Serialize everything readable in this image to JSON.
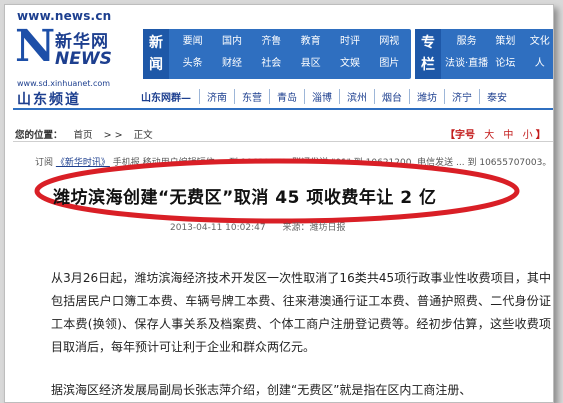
{
  "header": {
    "site_url": "www.news.cn",
    "logo_letter": "N",
    "logo_cn": "新华网",
    "logo_news": "NEWS",
    "sub_url": "www.sd.xinhuanet.com",
    "channel_name": "山东频道"
  },
  "nav_news": {
    "label": "新闻",
    "items": [
      "要闻",
      "国内",
      "齐鲁",
      "教育",
      "时评",
      "网视",
      "头条",
      "财经",
      "社会",
      "县区",
      "文娱",
      "图片"
    ]
  },
  "nav_topics": {
    "label": "专栏",
    "items": [
      "服务",
      "策划",
      "文化",
      "法谈·直播",
      "论坛",
      "人"
    ]
  },
  "city_bar": {
    "net_label": "山东网群—",
    "cities": [
      "济南",
      "东营",
      "青岛",
      "淄博",
      "滨州",
      "烟台",
      "潍坊",
      "济宁",
      "泰安"
    ]
  },
  "breadcrumb": {
    "location_label": "您的位置：",
    "items": [
      "首页",
      "> >",
      "正文"
    ]
  },
  "font_size": {
    "label": "【字号",
    "options": [
      "大",
      "中",
      "小"
    ],
    "close": "】"
  },
  "subscribe_line": {
    "prefix": "订阅",
    "link": "《新华时讯》",
    "tail": "手机报 移动用户编辑短信 ... 到 10621200, 联通发送 \"01\" 到 10621200, 电信发送 ... 到 10655707003。"
  },
  "article": {
    "headline": "潍坊滨海创建“无费区”取消 45 项收费年让 2 亿",
    "date": "2013-04-11 10:02:47",
    "source": "来源：潍坊日报",
    "paragraph_1": "从3月26日起，潍坊滨海经济技术开发区一次性取消了16类共45项行政事业性收费项目，其中包括居民户口簿工本费、车辆号牌工本费、往来港澳通行证工本费、普通护照费、二代身份证工本费(换领)、保存人事关系及档案费、个体工商户注册登记费等。经初步估算，这些收费项目取消后，每年预计可让利于企业和群众两亿元。",
    "paragraph_2": "据滨海区经济发展局副局长张志萍介绍，创建“无费区”就是指在区内工商注册、"
  },
  "colors": {
    "brand_blue": "#1d3f8f",
    "nav_blue": "#2f6fc0",
    "highlight_red": "#d91f26"
  }
}
